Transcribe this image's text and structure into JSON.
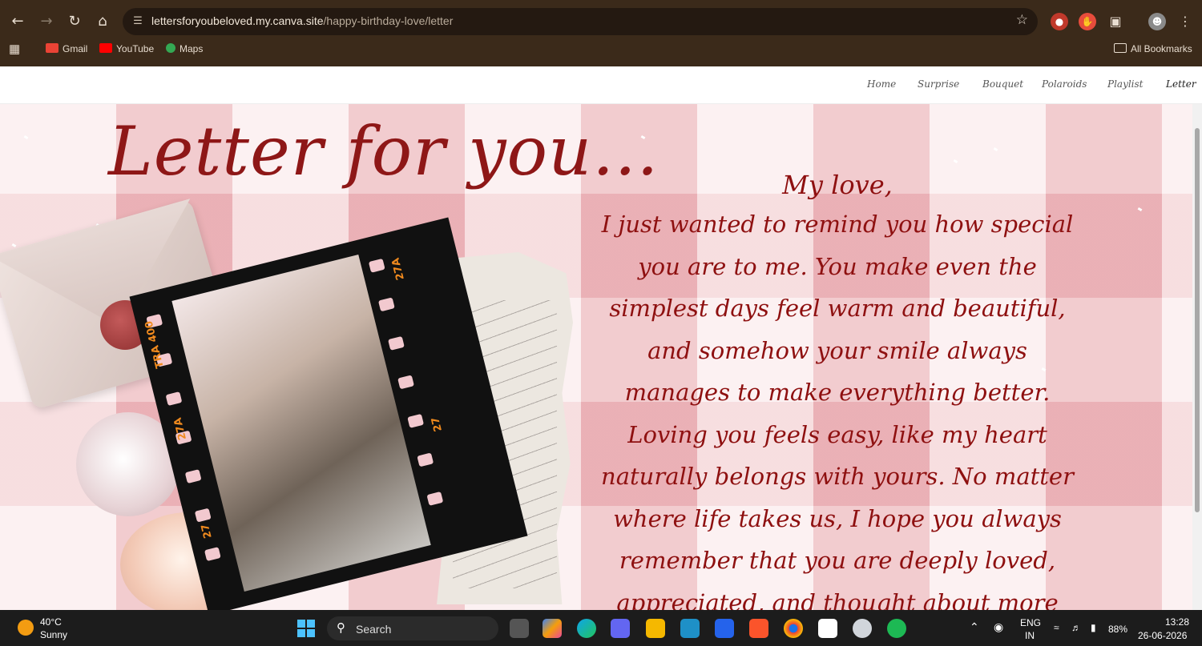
{
  "browser": {
    "url_domain": "lettersforyoubeloved.my.canva.site",
    "url_path": "/happy-birthday-love/letter",
    "bookmarks": [
      {
        "label": "Gmail",
        "color": "#ea4335"
      },
      {
        "label": "YouTube",
        "color": "#ff0000"
      },
      {
        "label": "Maps",
        "color": "#34a853"
      }
    ],
    "all_bookmarks": "All Bookmarks"
  },
  "site_nav": [
    "Home",
    "Surprise",
    "Bouquet",
    "Polaroids",
    "Playlist",
    "Letter"
  ],
  "page": {
    "title": "Letter for you...",
    "film_labels": [
      "TRA 400",
      "27A",
      "27",
      "27A",
      "27"
    ],
    "greeting": "My love,",
    "body_lines": [
      "I just wanted to remind you how special",
      "you are to me. You make even the",
      "simplest days feel warm and beautiful,",
      "and somehow your smile always",
      "manages to make everything better.",
      "Loving you feels easy, like my heart",
      "naturally belongs with yours. No matter",
      "where life takes us, I hope you always",
      "remember that you are deeply loved,",
      "appreciated, and thought about more"
    ]
  },
  "taskbar": {
    "temperature": "40°C",
    "condition": "Sunny",
    "search_label": "Search",
    "language": "ENG",
    "region": "IN",
    "battery": "88%",
    "time": "13:28",
    "date": "26-06-2026"
  },
  "colors": {
    "text_red": "#8e1010",
    "chrome": "#3b2a1a",
    "gingham": "#f7d9db"
  }
}
